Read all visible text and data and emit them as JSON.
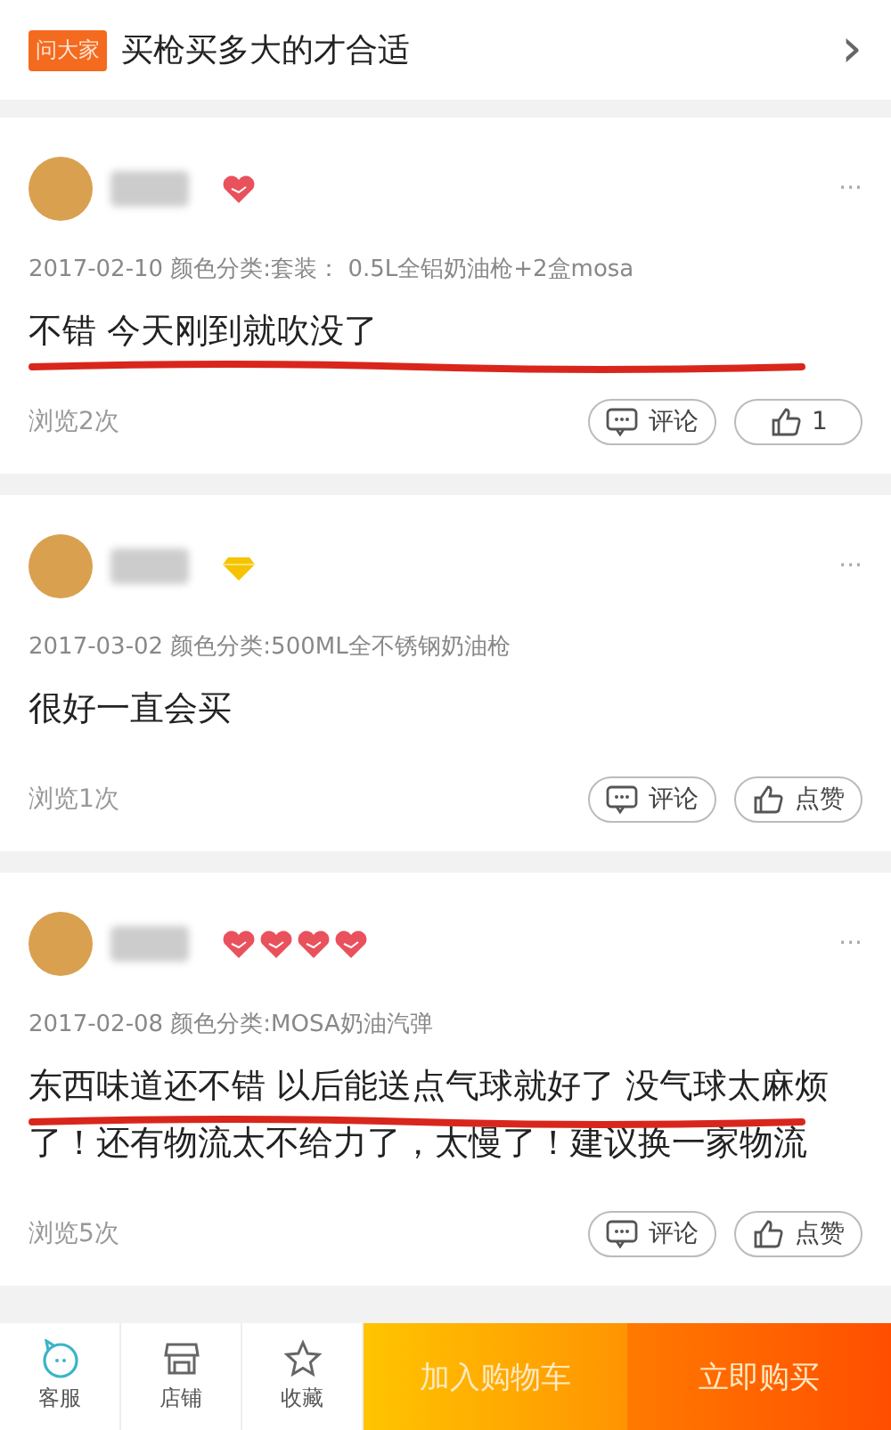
{
  "question_bar": {
    "badge": "问大家",
    "title": "买枪买多大的才合适",
    "chevron": "›"
  },
  "reviews": [
    {
      "badges": [
        {
          "kind": "heart"
        }
      ],
      "more": "···",
      "date": "2017-02-10",
      "variant": "颜色分类:套装：  0.5L全铝奶油枪+2盒mosa",
      "text": "不错 今天刚到就吹没了",
      "marked": true,
      "views": "浏览2次",
      "comment": "评论",
      "like": "1"
    },
    {
      "badges": [
        {
          "kind": "diamond"
        }
      ],
      "more": "···",
      "date": "2017-03-02",
      "variant": "颜色分类:500ML全不锈钢奶油枪",
      "text": "很好一直会买",
      "marked": false,
      "views": "浏览1次",
      "comment": "评论",
      "like": "点赞"
    },
    {
      "badges": [
        {
          "kind": "heart"
        },
        {
          "kind": "heart"
        },
        {
          "kind": "heart"
        },
        {
          "kind": "heart"
        }
      ],
      "more": "···",
      "date": "2017-02-08",
      "variant": "颜色分类:MOSA奶油汽弹",
      "text": "东西味道还不错  以后能送点气球就好了  没气球太麻烦了！还有物流太不给力了，太慢了！建议换一家物流",
      "marked": true,
      "views": "浏览5次",
      "comment": "评论",
      "like": "点赞"
    }
  ],
  "bottom_bar": {
    "icons": [
      {
        "kind": "chat",
        "label": "客服"
      },
      {
        "kind": "shop",
        "label": "店铺"
      },
      {
        "kind": "star",
        "label": "收藏"
      }
    ],
    "buttons": [
      {
        "kind": "cart",
        "label": "加入购物车"
      },
      {
        "kind": "buy",
        "label": "立即购买"
      }
    ]
  }
}
